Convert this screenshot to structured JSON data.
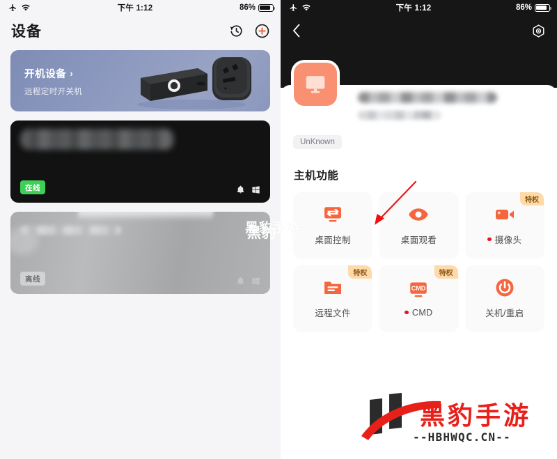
{
  "left": {
    "statusbar": {
      "airplane_icon": "airplane-icon",
      "wifi_icon": "wifi-icon",
      "time": "下午 1:12",
      "battery_pct": "86%"
    },
    "nav": {
      "title": "设备",
      "history_icon": "history-clock-icon",
      "add_icon": "plus-circle-icon"
    },
    "promo": {
      "title": "开机设备",
      "chevron": "›",
      "subtitle": "远程定时开关机",
      "image_alt": "smart-plug-device-image"
    },
    "devices": [
      {
        "status_label": "在线",
        "status": "online",
        "name_blurred": "",
        "bell_icon": "bell-icon",
        "os_icon": "windows-icon"
      },
      {
        "status_label": "离线",
        "status": "offline",
        "name_blurred": "",
        "bell_icon": "bell-icon",
        "os_icon": "windows-icon"
      }
    ]
  },
  "right": {
    "statusbar": {
      "airplane_icon": "airplane-icon",
      "wifi_icon": "wifi-icon",
      "time": "下午 1:12",
      "battery_pct": "86%"
    },
    "nav": {
      "back_icon": "chevron-left-icon",
      "settings_icon": "hex-settings-icon"
    },
    "device": {
      "avatar_icon": "monitor-icon",
      "name_blurred": "",
      "ip_tail": ".230",
      "status_chip": "UnKnown"
    },
    "section_title": "主机功能",
    "functions": [
      {
        "label": "桌面控制",
        "icon": "monitor-exchange-icon",
        "privilege": "",
        "dot": false
      },
      {
        "label": "桌面观看",
        "icon": "eye-icon",
        "privilege": "",
        "dot": false
      },
      {
        "label": "摄像头",
        "icon": "video-camera-icon",
        "privilege": "特权",
        "dot": true
      },
      {
        "label": "远程文件",
        "icon": "folder-icon",
        "privilege": "特权",
        "dot": false
      },
      {
        "label": "CMD",
        "icon": "cmd-monitor-icon",
        "privilege": "特权",
        "dot": true
      },
      {
        "label": "关机/重启",
        "icon": "power-icon",
        "privilege": "",
        "dot": false
      }
    ]
  },
  "watermarks": {
    "center": "黑豹手游",
    "offline_card": "黑豹",
    "logo_han": "黑豹手游",
    "logo_domain": "--HBHWQC.CN--"
  },
  "colors": {
    "accent": "#f4663e",
    "online": "#3ecf56",
    "privilege_bg": "#ffd9a8",
    "avatar_bg": "#fa9072",
    "red_dot": "#e8151b",
    "promo_bg": "#8d99bf",
    "logo_red": "#e8201a"
  }
}
